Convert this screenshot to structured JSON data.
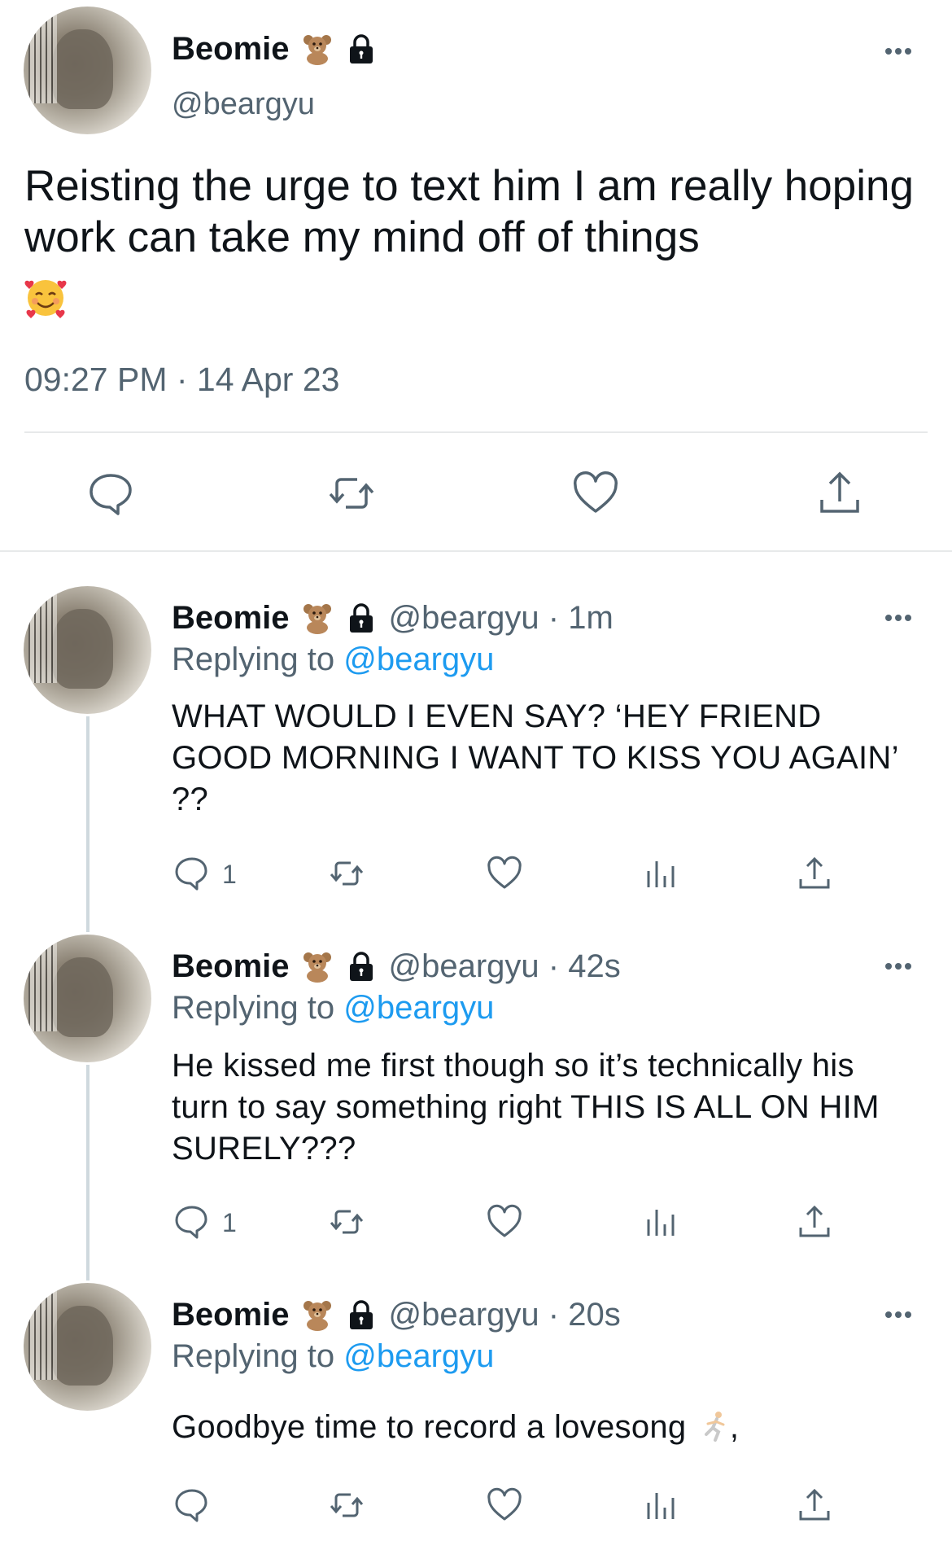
{
  "main_tweet": {
    "name": "Beomie",
    "handle": "@beargyu",
    "text": "Reisting the urge to text him I am really hoping work can take my mind off of things",
    "emoji": "smiling-face-with-hearts",
    "timestamp": "09:27 PM · 14 Apr 23"
  },
  "replies": [
    {
      "name": "Beomie",
      "meta": "@beargyu · 1m",
      "replying_prefix": "Replying to ",
      "replying_to": "@beargyu",
      "text": "WHAT WOULD I EVEN SAY? ‘HEY FRIEND GOOD MORNING I WANT TO KISS YOU AGAIN’ ??",
      "reply_count": "1"
    },
    {
      "name": "Beomie",
      "meta": "@beargyu · 42s",
      "replying_prefix": "Replying to ",
      "replying_to": "@beargyu",
      "text": "He kissed me first though so it’s technically his turn to say something right THIS IS ALL ON HIM SURELY???",
      "reply_count": "1"
    },
    {
      "name": "Beomie",
      "meta": "@beargyu · 20s",
      "replying_prefix": "Replying to ",
      "replying_to": "@beargyu",
      "text": "Goodbye time to record a lovesong",
      "trailing_emoji": "running-person",
      "trailing_punct": ",",
      "reply_count": ""
    }
  ],
  "colors": {
    "text": "#0f1419",
    "secondary": "#536471",
    "link": "#1d9bf0",
    "divider": "#e7e9ea",
    "thread_line": "#cfd9de"
  },
  "icons": [
    "teddy-bear-icon",
    "lock-icon",
    "more-icon",
    "reply-icon",
    "retweet-icon",
    "like-icon",
    "views-icon",
    "share-icon"
  ]
}
